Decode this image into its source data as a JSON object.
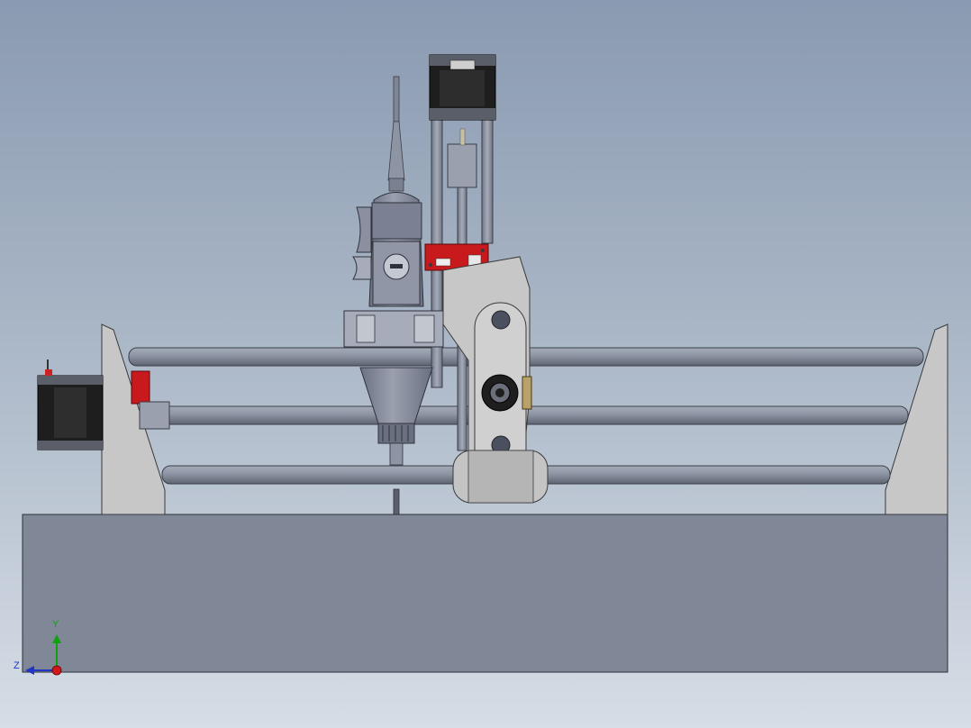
{
  "viewport": {
    "background_top": "#8a9ab1",
    "background_bottom": "#d6dde6"
  },
  "triad": {
    "y_label": "Y",
    "z_label": "Z",
    "colors": {
      "y": "#10a010",
      "z": "#1f35c4",
      "x_dot": "#d01a1a"
    }
  },
  "model": {
    "base_color": "#808898",
    "rod_color": "#8c93a2",
    "frame_color": "#c7c7c7",
    "board_color": "#c8191c",
    "motor_color": "#1e1e1e"
  }
}
